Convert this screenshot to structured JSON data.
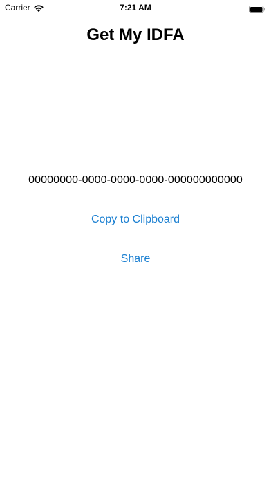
{
  "status_bar": {
    "carrier": "Carrier",
    "time": "7:21 AM",
    "icons": [
      "wifi-icon",
      "battery-icon"
    ]
  },
  "page": {
    "title": "Get My IDFA",
    "idfa": "00000000-0000-0000-0000-000000000000"
  },
  "actions": {
    "copy_label": "Copy to Clipboard",
    "share_label": "Share"
  },
  "colors": {
    "accent": "#1a7fd1",
    "text": "#000000",
    "background": "#ffffff"
  }
}
